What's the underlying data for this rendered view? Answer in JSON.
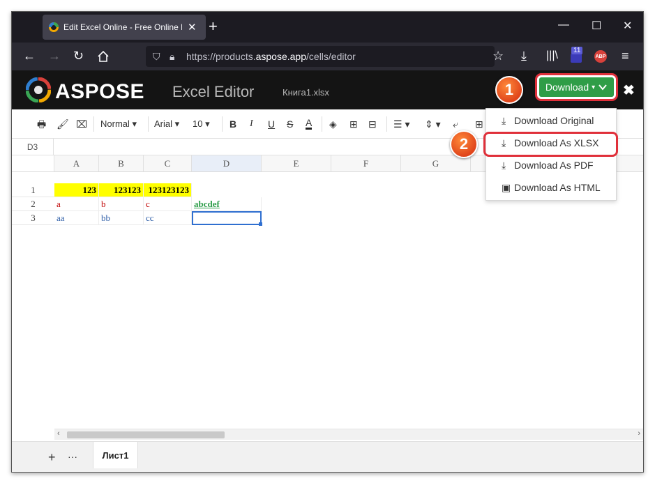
{
  "browser": {
    "tab_title": "Edit Excel Online - Free Online E",
    "url_prefix": "https://products.",
    "url_domain": "aspose.app",
    "url_path": "/cells/editor",
    "extension_badge": "11",
    "abp_label": "ABP"
  },
  "app": {
    "brand": "ASPOSE",
    "app_name": "Excel Editor",
    "file_name": "Книга1.xlsx",
    "download_label": "Download",
    "close_glyph": "✖"
  },
  "callouts": {
    "first": "1",
    "second": "2"
  },
  "toolbar": {
    "style_select": "Normal",
    "font_select": "Arial",
    "size_select": "10"
  },
  "formula_bar": {
    "cell_ref": "D3"
  },
  "grid": {
    "columns": [
      "A",
      "B",
      "C",
      "D",
      "E",
      "F",
      "G"
    ],
    "rows": [
      "1",
      "2",
      "3"
    ],
    "cells": {
      "A1": "123",
      "B1": "123123",
      "C1": "123123123",
      "A2": "a",
      "B2": "b",
      "C2": "c",
      "D2": "abcdef",
      "A3": "aa",
      "B3": "bb",
      "C3": "cc"
    }
  },
  "download_menu": {
    "items": [
      "Download Original",
      "Download As XLSX",
      "Download As PDF",
      "Download As HTML"
    ],
    "highlighted": "Download As XLSX"
  },
  "sheets": {
    "tabs": [
      "Лист1"
    ],
    "add_glyph": "+",
    "more_glyph": "···"
  },
  "colors": {
    "accent_green": "#2f9d47",
    "highlight_red": "#e0303a",
    "callout_orange": "#e0451b",
    "yellow_fill": "#ffff00",
    "red_text": "#c00000",
    "green_link": "#2e9e4a",
    "blue_text": "#2f5fa8"
  },
  "icons": [
    "firefox-logo-icon",
    "close-icon",
    "plus-icon",
    "minimize-icon",
    "maximize-icon",
    "back-arrow-icon",
    "forward-arrow-icon",
    "reload-icon",
    "home-icon",
    "shield-icon",
    "lock-icon",
    "star-icon",
    "download-arrow-icon",
    "library-icon",
    "menu-icon",
    "print-icon",
    "paint-format-icon",
    "clear-format-icon",
    "bold-icon",
    "italic-icon",
    "underline-icon",
    "strikethrough-icon",
    "text-color-icon",
    "fill-color-icon",
    "borders-icon",
    "merge-cells-icon",
    "align-left-icon",
    "vertical-align-icon",
    "wrap-text-icon",
    "download-icon",
    "html-icon"
  ]
}
